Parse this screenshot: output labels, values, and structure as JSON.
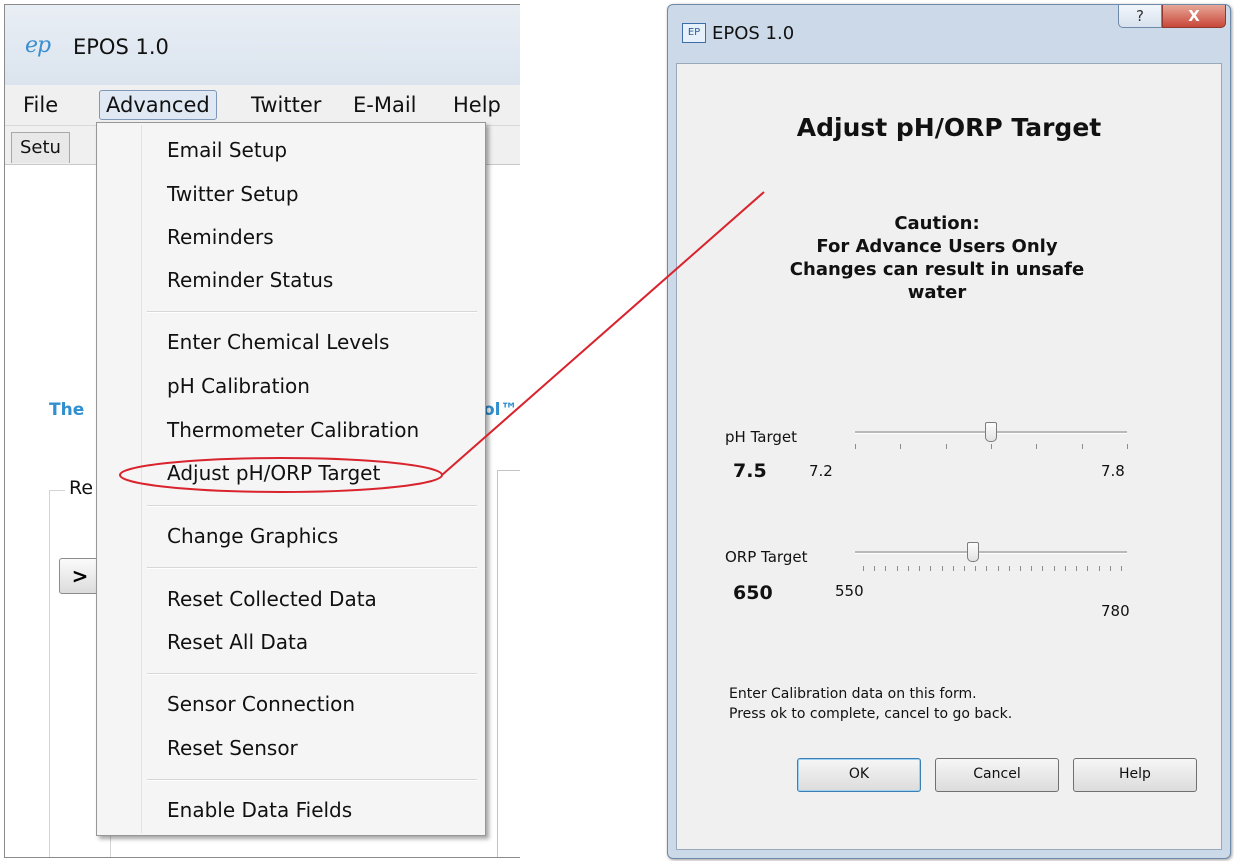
{
  "main_window": {
    "title": "EPOS 1.0",
    "logo_text": "ep",
    "menu": [
      "File",
      "Advanced",
      "Twitter",
      "E-Mail",
      "Help"
    ],
    "tab_label": "Setu",
    "tagline_start": "The ",
    "tagline_end": "ol™",
    "group_label": "Re",
    "arrow_button": ">"
  },
  "advanced_menu": {
    "items": [
      "Email Setup",
      "Twitter Setup",
      "Reminders",
      "Reminder Status",
      "Enter Chemical Levels",
      "pH Calibration",
      "Thermometer Calibration",
      "Adjust pH/ORP Target",
      "Change Graphics",
      "Reset Collected Data",
      "Reset All Data",
      "Sensor Connection",
      "Reset Sensor",
      "Enable Data Fields"
    ],
    "highlighted_item": "Adjust pH/ORP Target"
  },
  "dialog": {
    "title": "EPOS 1.0",
    "help_caption": "?",
    "close_caption": "X",
    "heading": "Adjust pH/ORP Target",
    "caution_lines": [
      "Caution:",
      "For Advance Users Only",
      "Changes can result in unsafe",
      "water"
    ],
    "ph": {
      "label": "pH Target",
      "value": "7.5",
      "min_label": "7.2",
      "max_label": "7.8",
      "position": 0.5
    },
    "orp": {
      "label": "ORP Target",
      "value": "650",
      "min_label": "550",
      "max_label": "780",
      "position": 0.435
    },
    "instructions": [
      "Enter  Calibration data on this form.",
      "Press ok to complete, cancel to go back."
    ],
    "buttons": {
      "ok": "OK",
      "cancel": "Cancel",
      "help": "Help"
    }
  },
  "colors": {
    "callout": "#d9232d",
    "tagline": "#2f8fd0"
  }
}
